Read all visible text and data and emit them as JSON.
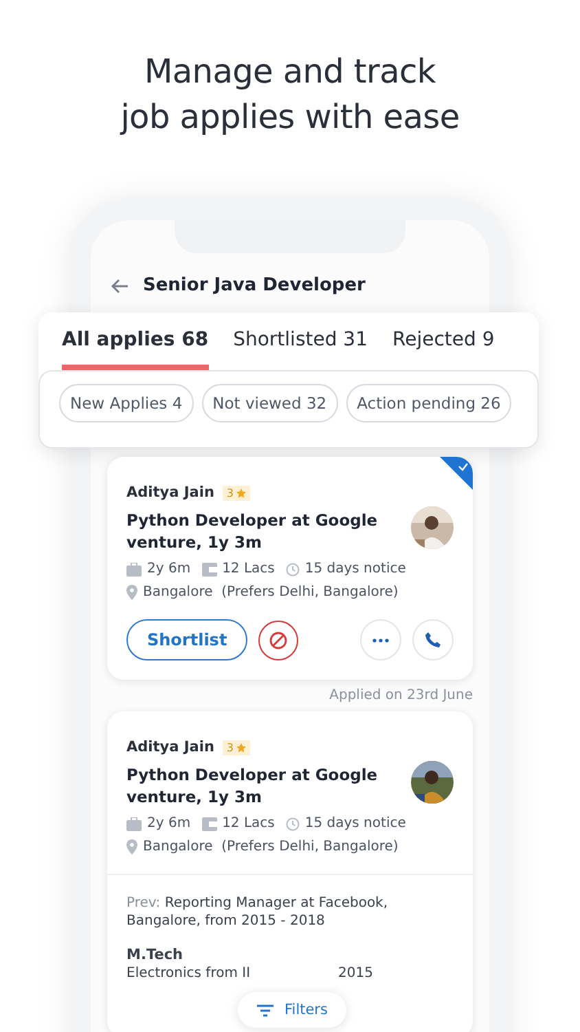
{
  "headline": [
    "Manage and track",
    "job applies with ease"
  ],
  "screen": {
    "title": "Senior Java Developer"
  },
  "tabs": [
    {
      "label": "All applies 68",
      "selected": true
    },
    {
      "label": "Shortlisted 31",
      "selected": false
    },
    {
      "label": "Rejected 9",
      "selected": false
    }
  ],
  "chips": [
    "New Applies 4",
    "Not viewed 32",
    "Action pending 26"
  ],
  "candidates": [
    {
      "name": "Aditya Jain",
      "rating": "3",
      "role": "Python Developer at Google venture, 1y 3m",
      "experience": "2y 6m",
      "salary": "12 Lacs",
      "notice": "15 days notice",
      "location": "Bangalore  (Prefers Delhi, Bangalore)",
      "selected": true,
      "actions": {
        "shortlist": "Shortlist"
      },
      "applied": "Applied on 23rd June"
    },
    {
      "name": "Aditya Jain",
      "rating": "3",
      "role": "Python Developer at Google venture, 1y 3m",
      "experience": "2y 6m",
      "salary": "12 Lacs",
      "notice": "15 days notice",
      "location": "Bangalore  (Prefers Delhi, Bangalore)",
      "selected": false,
      "previous": {
        "label": "Prev:",
        "text": "Reporting Manager at Facebook, Bangalore, from 2015 - 2018"
      },
      "education": {
        "degree": "M.Tech",
        "detail_start": "Electronics from II",
        "detail_end": "2015"
      }
    }
  ],
  "filters_button": "Filters"
}
